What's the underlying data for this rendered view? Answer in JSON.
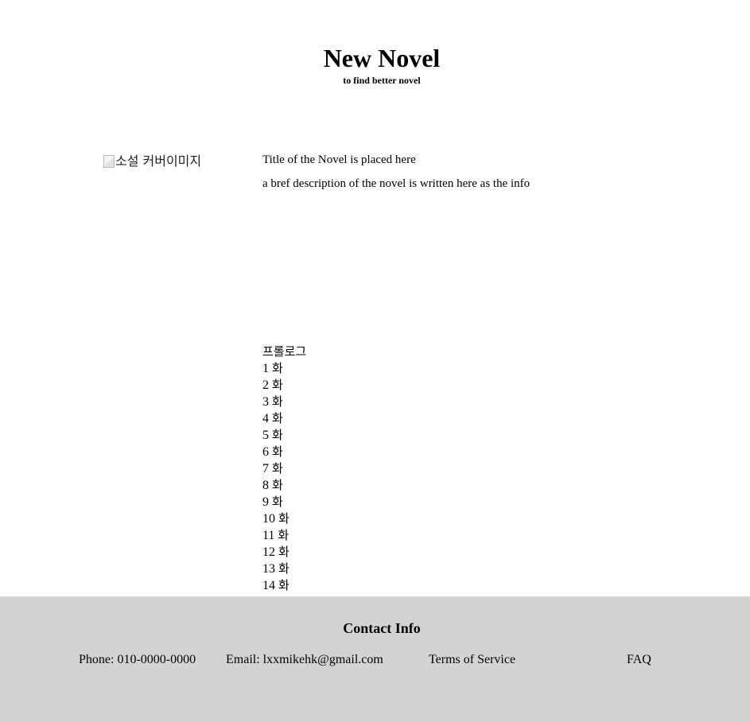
{
  "header": {
    "title": "New Novel",
    "tagline": "to find better novel"
  },
  "novel": {
    "cover_alt": "소설 커버이미지",
    "title": "Title of the Novel is placed here",
    "description": "a bref description of the novel is written here as the info"
  },
  "chapters": [
    {
      "num": "",
      "label": "프롤로그"
    },
    {
      "num": "1",
      "label": "화"
    },
    {
      "num": "2",
      "label": "화"
    },
    {
      "num": "3",
      "label": "화"
    },
    {
      "num": "4",
      "label": "화"
    },
    {
      "num": "5",
      "label": "화"
    },
    {
      "num": "6",
      "label": "화"
    },
    {
      "num": "7",
      "label": "화"
    },
    {
      "num": "8",
      "label": "화"
    },
    {
      "num": "9",
      "label": "화"
    },
    {
      "num": "10",
      "label": "화"
    },
    {
      "num": "11",
      "label": "화"
    },
    {
      "num": "12",
      "label": "화"
    },
    {
      "num": "13",
      "label": "화"
    },
    {
      "num": "14",
      "label": "화"
    }
  ],
  "footer": {
    "heading": "Contact Info",
    "phone": "Phone: 010-0000-0000",
    "email": "Email: lxxmikehk@gmail.com",
    "terms": "Terms of Service",
    "faq": "FAQ"
  }
}
